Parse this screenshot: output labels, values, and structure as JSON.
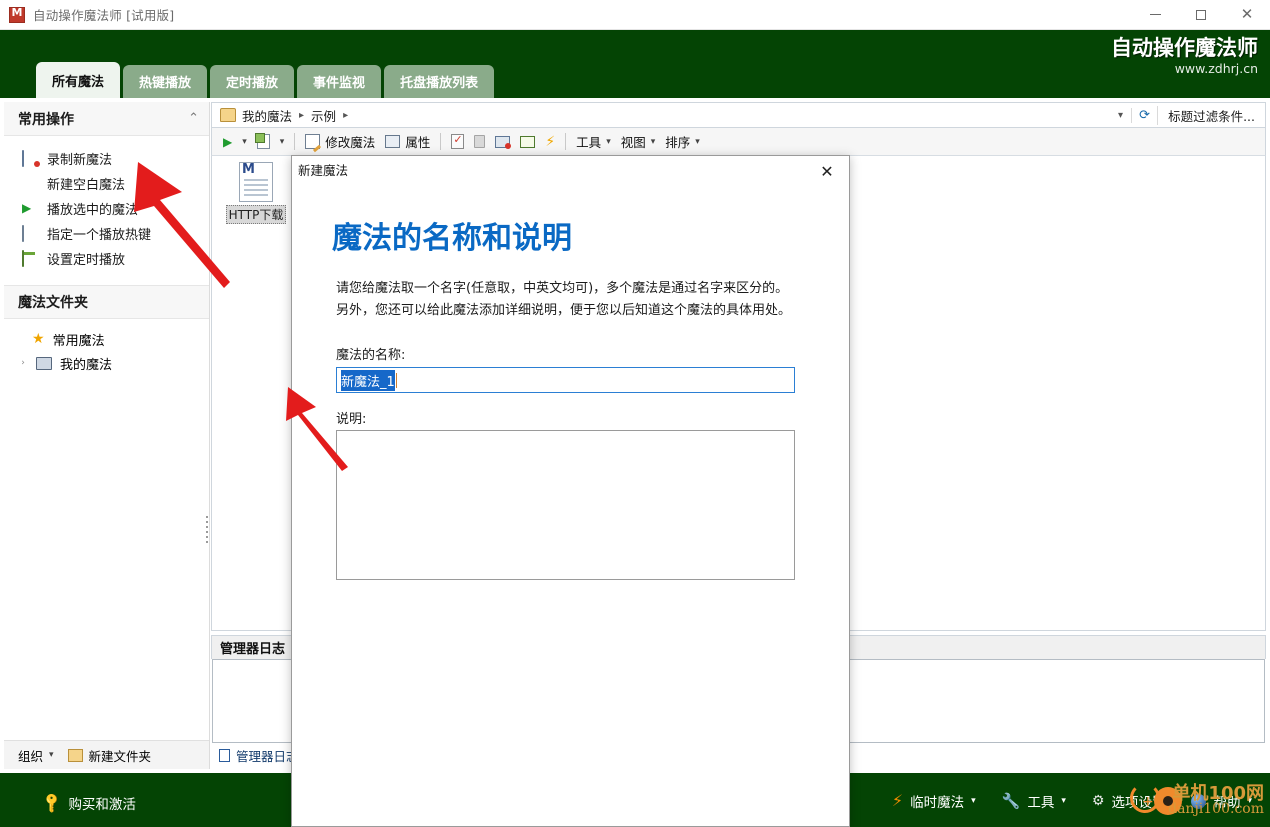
{
  "window": {
    "title": "自动操作魔法师 [试用版]",
    "app_icon": "app-icon-m",
    "minimize": "—",
    "maximize": "□",
    "close": "✕"
  },
  "header": {
    "brand_title": "自动操作魔法师",
    "brand_url": "www.zdhrj.cn",
    "tabs": [
      {
        "label": "所有魔法",
        "active": true
      },
      {
        "label": "热键播放",
        "active": false
      },
      {
        "label": "定时播放",
        "active": false
      },
      {
        "label": "事件监视",
        "active": false
      },
      {
        "label": "托盘播放列表",
        "active": false
      }
    ]
  },
  "sidebar": {
    "section1_title": "常用操作",
    "collapse_glyph": "⌃",
    "items": [
      {
        "label": "录制新魔法",
        "icon": "record-monitor-icon"
      },
      {
        "label": "新建空白魔法",
        "icon": "none"
      },
      {
        "label": "播放选中的魔法",
        "icon": "play-icon"
      },
      {
        "label": "指定一个播放热键",
        "icon": "keyboard-icon"
      },
      {
        "label": "设置定时播放",
        "icon": "calendar-icon"
      }
    ],
    "section2_title": "魔法文件夹",
    "folders": [
      {
        "label": "常用魔法",
        "icon": "star-icon",
        "caret": ""
      },
      {
        "label": "我的魔法",
        "icon": "computer-icon",
        "caret": "›"
      }
    ],
    "footer_organize": "组织",
    "footer_organize_caret": "▾",
    "footer_newfolder": "新建文件夹"
  },
  "breadcrumb": {
    "folder_icon": "folder-icon",
    "parts": [
      "我的魔法",
      "示例"
    ],
    "separator": "▸",
    "dropdown_caret": "▾",
    "refresh_icon": "refresh-icon",
    "filter_label": "标题过滤条件..."
  },
  "toolbar": {
    "play_icon": "play-icon",
    "play_caret": "▾",
    "new_icon": "new-document-icon",
    "new_caret": "▾",
    "edit_label": "修改魔法",
    "edit_icon": "edit-magic-icon",
    "prop_label": "属性",
    "prop_icon": "properties-icon",
    "clipboard_icon": "clipboard-check-icon",
    "lock_icon": "lock-icon",
    "record_icon": "record-monitor-icon",
    "schedule_icon": "calendar-icon",
    "bolt_icon": "lightning-icon",
    "tools_label": "工具",
    "view_label": "视图",
    "sort_label": "排序",
    "menu_caret": "▾"
  },
  "filelist": {
    "items": [
      {
        "label": "HTTP下载",
        "icon": "macro-document-icon",
        "selected": true
      }
    ]
  },
  "logpanel": {
    "title": "管理器日志",
    "tab_label": "管理器日志",
    "tab_icon": "log-document-icon"
  },
  "footer": {
    "buy_label": "购买和激活",
    "buy_icon": "key-icon",
    "items": [
      {
        "label": "临时魔法",
        "icon": "lightning-icon",
        "caret": "▾"
      },
      {
        "label": "工具",
        "icon": "wrench-icon",
        "caret": "▾"
      },
      {
        "label": "选项设置",
        "icon": "gear-icon",
        "caret": ""
      },
      {
        "label": "帮助",
        "icon": "help-icon",
        "caret": "▾"
      }
    ]
  },
  "watermark": {
    "cn": "单机100网",
    "en": "danji100.com"
  },
  "dialog": {
    "title": "新建魔法",
    "close_glyph": "✕",
    "heading": "魔法的名称和说明",
    "paragraph": "请您给魔法取一个名字(任意取，中英文均可)，多个魔法是通过名字来区分的。另外，您还可以给此魔法添加详细说明，便于您以后知道这个魔法的具体用处。",
    "name_label": "魔法的名称:",
    "name_value": "新魔法_1",
    "name_placeholder": "",
    "desc_label": "说明:",
    "desc_value": "",
    "desc_placeholder": ""
  },
  "colors": {
    "brand_green": "#044404",
    "tab_inactive": "#8aab8a",
    "heading_blue": "#0a69c4",
    "selection_blue": "#1668c9",
    "arrow_red": "#e31c1c"
  }
}
